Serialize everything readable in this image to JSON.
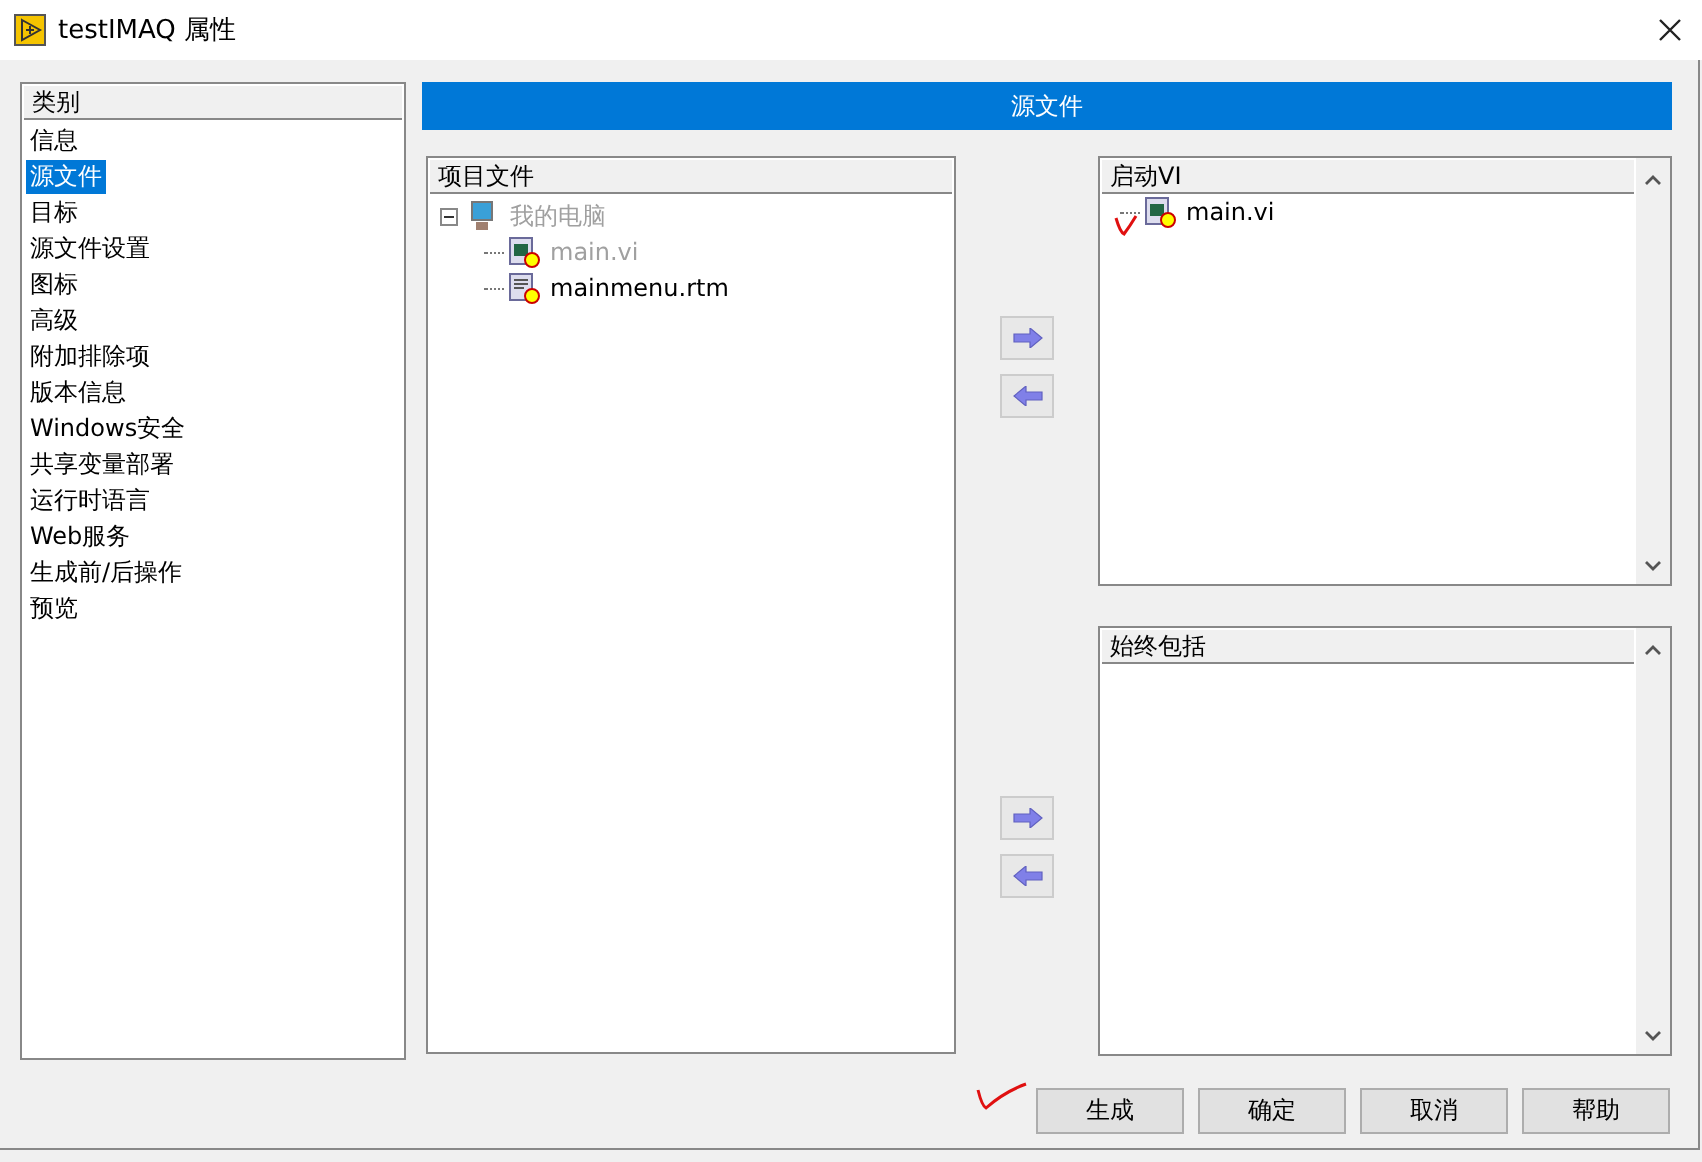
{
  "window": {
    "title": "testIMAQ 属性"
  },
  "sidebar": {
    "header": "类别",
    "items": [
      {
        "label": "信息",
        "selected": false
      },
      {
        "label": "源文件",
        "selected": true
      },
      {
        "label": "目标",
        "selected": false
      },
      {
        "label": "源文件设置",
        "selected": false
      },
      {
        "label": "图标",
        "selected": false
      },
      {
        "label": "高级",
        "selected": false
      },
      {
        "label": "附加排除项",
        "selected": false
      },
      {
        "label": "版本信息",
        "selected": false
      },
      {
        "label": "Windows安全",
        "selected": false
      },
      {
        "label": "共享变量部署",
        "selected": false
      },
      {
        "label": "运行时语言",
        "selected": false
      },
      {
        "label": "Web服务",
        "selected": false
      },
      {
        "label": "生成前/后操作",
        "selected": false
      },
      {
        "label": "预览",
        "selected": false
      }
    ]
  },
  "section_title": "源文件",
  "project_files": {
    "header": "项目文件",
    "tree": [
      {
        "label": "我的电脑",
        "kind": "computer",
        "expanded": true,
        "disabled": true,
        "children": [
          {
            "label": "main.vi",
            "kind": "vi",
            "disabled": true
          },
          {
            "label": "mainmenu.rtm",
            "kind": "rtm",
            "disabled": false
          }
        ]
      }
    ]
  },
  "startup_vis": {
    "header": "启动VI",
    "items": [
      {
        "label": "main.vi",
        "kind": "vi"
      }
    ]
  },
  "always_included": {
    "header": "始终包括"
  },
  "buttons": [
    {
      "label": "生成"
    },
    {
      "label": "确定"
    },
    {
      "label": "取消"
    },
    {
      "label": "帮助"
    }
  ]
}
